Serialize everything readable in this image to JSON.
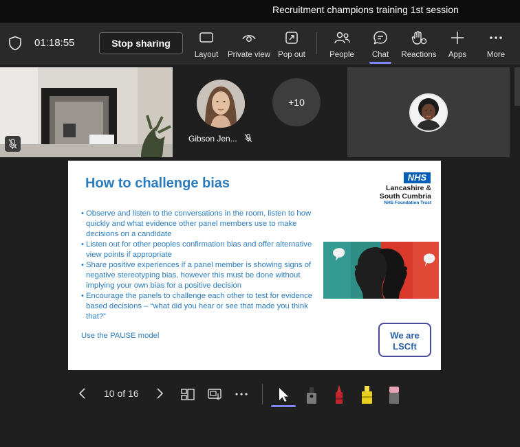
{
  "window": {
    "title": "Recruitment champions training 1st session"
  },
  "meeting": {
    "elapsed": "01:18:55",
    "stop_sharing_label": "Stop sharing",
    "toolbar": [
      {
        "id": "layout",
        "label": "Layout",
        "icon": "layout-icon"
      },
      {
        "id": "private-view",
        "label": "Private view",
        "icon": "eye-icon"
      },
      {
        "id": "pop-out",
        "label": "Pop out",
        "icon": "pop-out-icon"
      },
      {
        "id": "people",
        "label": "People",
        "icon": "people-icon"
      },
      {
        "id": "chat",
        "label": "Chat",
        "icon": "chat-icon",
        "active": true
      },
      {
        "id": "reactions",
        "label": "Reactions",
        "icon": "raise-hand-icon"
      },
      {
        "id": "apps",
        "label": "Apps",
        "icon": "plus-icon"
      },
      {
        "id": "more",
        "label": "More",
        "icon": "more-icon"
      }
    ],
    "accent_color": "#7f85f5"
  },
  "participants": {
    "gibson_name": "Gibson Jen...",
    "overflow_count": "+10"
  },
  "slide": {
    "title": "How to challenge bias",
    "bullets": [
      "Observe and listen to the conversations in the room, listen to how quickly and what evidence other panel members use to make decisions on a candidate",
      "Listen out for other peoples confirmation bias and offer alternative view points if appropriate",
      "Share positive experiences if a panel member is showing signs of negative stereotyping bias, however this must be done without implying your own bias for a positive decision",
      "Encourage the panels to challenge each other to test for evidence based decisions – “what did you hear or see that made you think that?”"
    ],
    "footer_text": "Use the PAUSE model",
    "logo": {
      "mark": "NHS",
      "line1": "Lancashire &",
      "line2": "South Cumbria",
      "line3": "NHS Foundation Trust"
    },
    "badge": {
      "line1": "We are",
      "line2": "LSCft"
    },
    "text_color": "#2a7cbf",
    "nhs_blue": "#005eb8"
  },
  "presenter": {
    "page_indicator": "10 of 16",
    "tools": [
      "previous-icon",
      "next-icon",
      "grid-view-icon",
      "slide-notes-icon",
      "more-icon",
      "laser-pointer-icon",
      "pen-black-icon",
      "pen-red-icon",
      "highlighter-icon",
      "eraser-icon"
    ]
  }
}
